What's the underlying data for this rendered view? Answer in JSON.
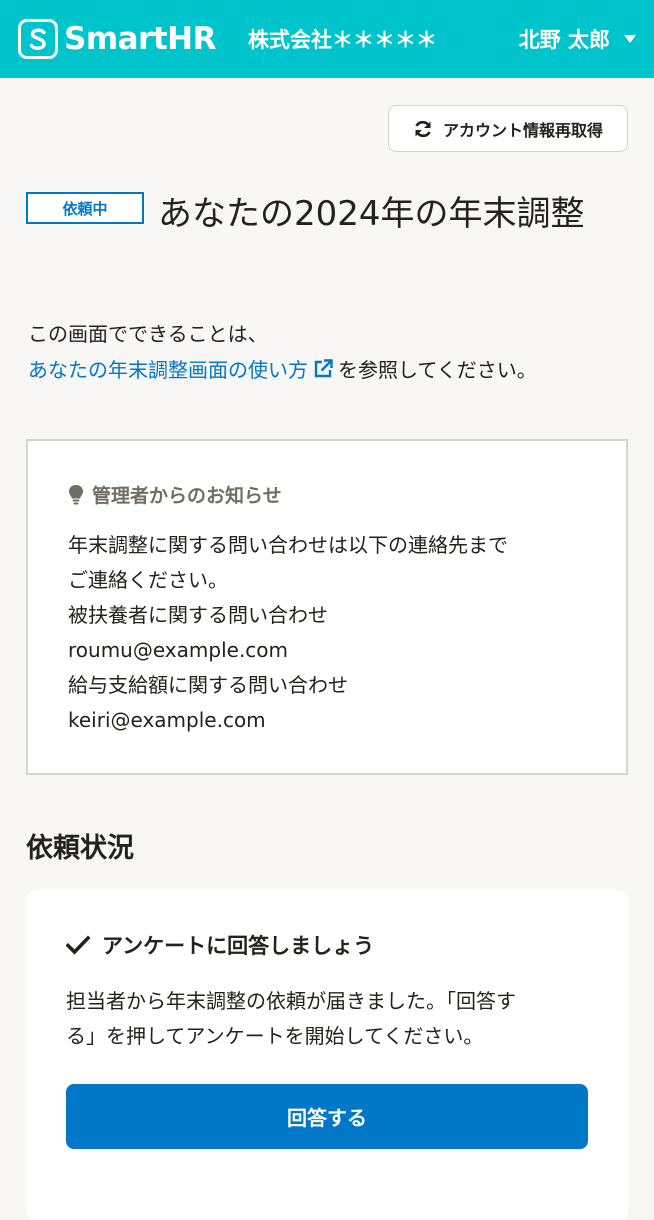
{
  "header": {
    "logo_text": "SmartHR",
    "company": "株式会社＊＊＊＊＊",
    "user_name": "北野 太郎",
    "bg_color": "#00c4cc"
  },
  "toolbar": {
    "refresh_label": "アカウント情報再取得",
    "refresh_icon": "refresh-icon"
  },
  "main": {
    "status_badge": "依頼中",
    "title": "あなたの2024年の年末調整",
    "intro_line1": "この画面でできることは、",
    "intro_link": "あなたの年末調整画面の使い方",
    "intro_suffix": "を参照してください。"
  },
  "notice": {
    "title": "管理者からのお知らせ",
    "lines": [
      "年末調整に関する問い合わせは以下の連絡先まで",
      "ご連絡ください。",
      "被扶養者に関する問い合わせ",
      "roumu@example.com",
      "給与支給額に関する問い合わせ",
      "keiri@example.com"
    ]
  },
  "status_section": {
    "title": "依頼状況",
    "task_title": "アンケートに回答しましょう",
    "task_desc_line1": "担当者から年末調整の依頼が届きました。「回答す",
    "task_desc_line2": "る」を押してアンケートを開始してください。",
    "answer_button": "回答する"
  },
  "colors": {
    "accent": "#0077c7",
    "brand": "#00c4cc",
    "background": "#f8f7f6"
  }
}
